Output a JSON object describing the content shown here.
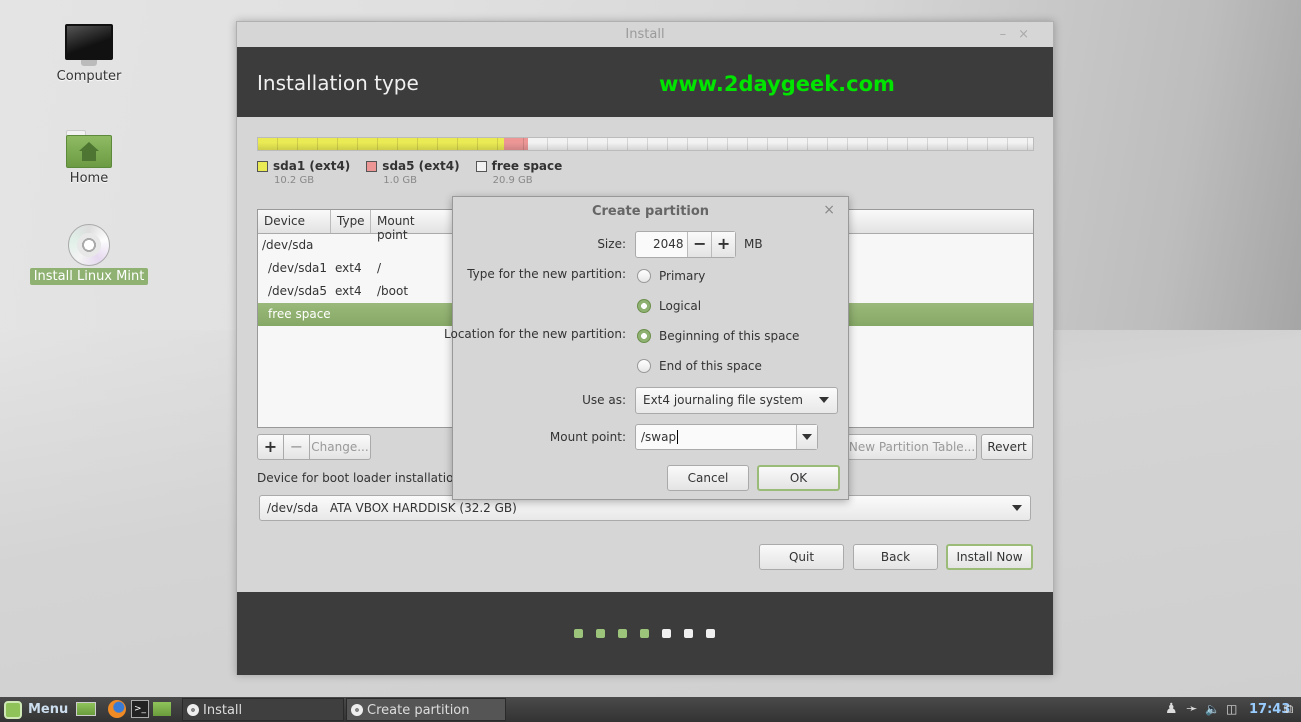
{
  "desktop": {
    "icons": [
      {
        "label": "Computer",
        "icon": "computer-icon"
      },
      {
        "label": "Home",
        "icon": "home-folder-icon"
      },
      {
        "label": "Install Linux Mint",
        "icon": "disc-icon",
        "selected": true
      }
    ]
  },
  "window": {
    "title": "Install",
    "minimize": "–",
    "close": "×",
    "header_title": "Installation type",
    "watermark": "www.2daygeek.com",
    "partition_bar": [
      {
        "name": "sda1 (ext4)",
        "size": "10.2 GB",
        "size_gb": 10.2,
        "color": "#eaea54"
      },
      {
        "name": "sda5 (ext4)",
        "size": "1.0 GB",
        "size_gb": 1.0,
        "color": "#ec9696"
      },
      {
        "name": "free space",
        "size": "20.9 GB",
        "size_gb": 20.9,
        "color": "#f2f2f2"
      }
    ],
    "table": {
      "columns": [
        "Device",
        "Type",
        "Mount point"
      ],
      "rows": [
        {
          "device": "/dev/sda",
          "type": "",
          "mount": ""
        },
        {
          "device": "/dev/sda1",
          "type": "ext4",
          "mount": "/"
        },
        {
          "device": "/dev/sda5",
          "type": "ext4",
          "mount": "/boot"
        },
        {
          "device": "free space",
          "type": "",
          "mount": "",
          "selected": true
        }
      ]
    },
    "buttons": {
      "add": "+",
      "remove": "−",
      "change": "Change...",
      "new_table": "New Partition Table...",
      "revert": "Revert",
      "quit": "Quit",
      "back": "Back",
      "install": "Install Now"
    },
    "boot_loader_label": "Device for boot loader installation:",
    "boot_loader_value": "/dev/sda   ATA VBOX HARDDISK (32.2 GB)",
    "progress": {
      "total_steps": 7,
      "completed_steps": 4,
      "done_color": "#9cc47a",
      "todo_color": "#f0f0f0"
    }
  },
  "dialog": {
    "title": "Create partition",
    "close": "×",
    "size_label": "Size:",
    "size_value": "2048",
    "size_unit": "MB",
    "decrement": "−",
    "increment": "+",
    "type_label": "Type for the new partition:",
    "type_options": [
      {
        "label": "Primary",
        "checked": false
      },
      {
        "label": "Logical",
        "checked": true
      }
    ],
    "location_label": "Location for the new partition:",
    "location_options": [
      {
        "label": "Beginning of this space",
        "checked": true
      },
      {
        "label": "End of this space",
        "checked": false
      }
    ],
    "use_as_label": "Use as:",
    "use_as_value": "Ext4 journaling file system",
    "mount_label": "Mount point:",
    "mount_value": "/swap",
    "cancel": "Cancel",
    "ok": "OK"
  },
  "taskbar": {
    "menu": "Menu",
    "windows": [
      {
        "label": "Install",
        "active": false
      },
      {
        "label": "Create partition",
        "active": true
      }
    ],
    "clock": "17:43"
  }
}
